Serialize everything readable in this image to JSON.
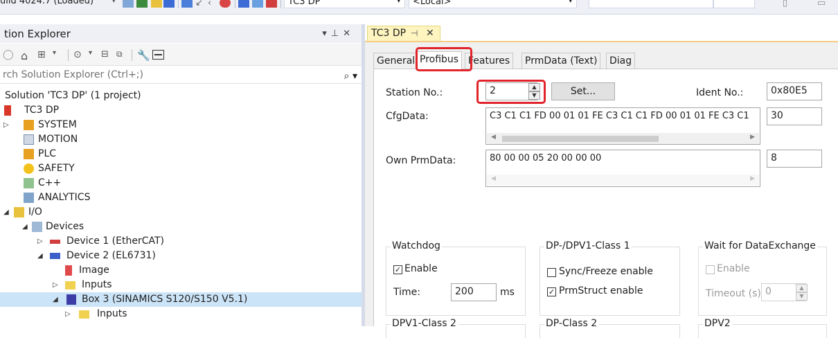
{
  "toolbar": {
    "build_text": "uild 4024.7 (Loaded)",
    "project_combo": "TC3 DP",
    "target_combo": "<Local>"
  },
  "explorer": {
    "title": "tion Explorer",
    "search_placeholder": "rch Solution Explorer (Ctrl+;)",
    "tree": [
      {
        "label": "Solution 'TC3 DP' (1 project)",
        "icon": "solution-icon"
      },
      {
        "label": "TC3 DP",
        "icon": "project-icon"
      },
      {
        "label": "SYSTEM",
        "icon": "system-icon"
      },
      {
        "label": "MOTION",
        "icon": "motion-icon"
      },
      {
        "label": "PLC",
        "icon": "plc-icon"
      },
      {
        "label": "SAFETY",
        "icon": "safety-icon"
      },
      {
        "label": "C++",
        "icon": "cpp-icon"
      },
      {
        "label": "ANALYTICS",
        "icon": "analytics-icon"
      },
      {
        "label": "I/O",
        "icon": "io-icon"
      },
      {
        "label": "Devices",
        "icon": "devices-icon"
      },
      {
        "label": "Device 1 (EtherCAT)",
        "icon": "ethercat-device-icon"
      },
      {
        "label": "Device 2 (EL6731)",
        "icon": "profibus-device-icon"
      },
      {
        "label": "Image",
        "icon": "image-icon"
      },
      {
        "label": "Inputs",
        "icon": "folder-icon"
      },
      {
        "label": "Box 3 (SINAMICS S120/S150 V5.1)",
        "icon": "box-icon"
      },
      {
        "label": "Inputs",
        "icon": "folder-icon"
      }
    ]
  },
  "editor": {
    "doc_tab": "TC3 DP",
    "tabs": [
      "General",
      "Profibus",
      "Features",
      "PrmData (Text)",
      "Diag"
    ],
    "active_tab": "Profibus",
    "station_label": "Station No.:",
    "station_value": "2",
    "set_button": "Set...",
    "ident_label": "Ident No.:",
    "ident_value": "0x80E5",
    "cfg_label": "CfgData:",
    "cfg_value": "C3 C1 C1 FD 00 01 01 FE C3 C1 C1 FD 00 01 01 FE C3 C1",
    "cfg_len": "30",
    "prm_label": "Own PrmData:",
    "prm_value": "80 00 00 05 20 00 00 00",
    "prm_len": "8",
    "watchdog": {
      "title": "Watchdog",
      "enable_label": "Enable",
      "enable_checked": true,
      "time_label": "Time:",
      "time_value": "200",
      "time_unit": "ms"
    },
    "dpv1_class1": {
      "title": "DP-/DPV1-Class 1",
      "sync_label": "Sync/Freeze enable",
      "sync_checked": false,
      "prm_label": "PrmStruct enable",
      "prm_checked": true
    },
    "wait_dx": {
      "title": "Wait for DataExchange",
      "enable_label": "Enable",
      "timeout_label": "Timeout (s):",
      "timeout_value": "0"
    },
    "bottom_groups": [
      "DPV1-Class 2",
      "DP-Class 2",
      "DPV2"
    ]
  },
  "colors": {
    "highlight": "#e0242a",
    "selection": "#cce4f7",
    "doc_tab": "#fdf4bf"
  }
}
